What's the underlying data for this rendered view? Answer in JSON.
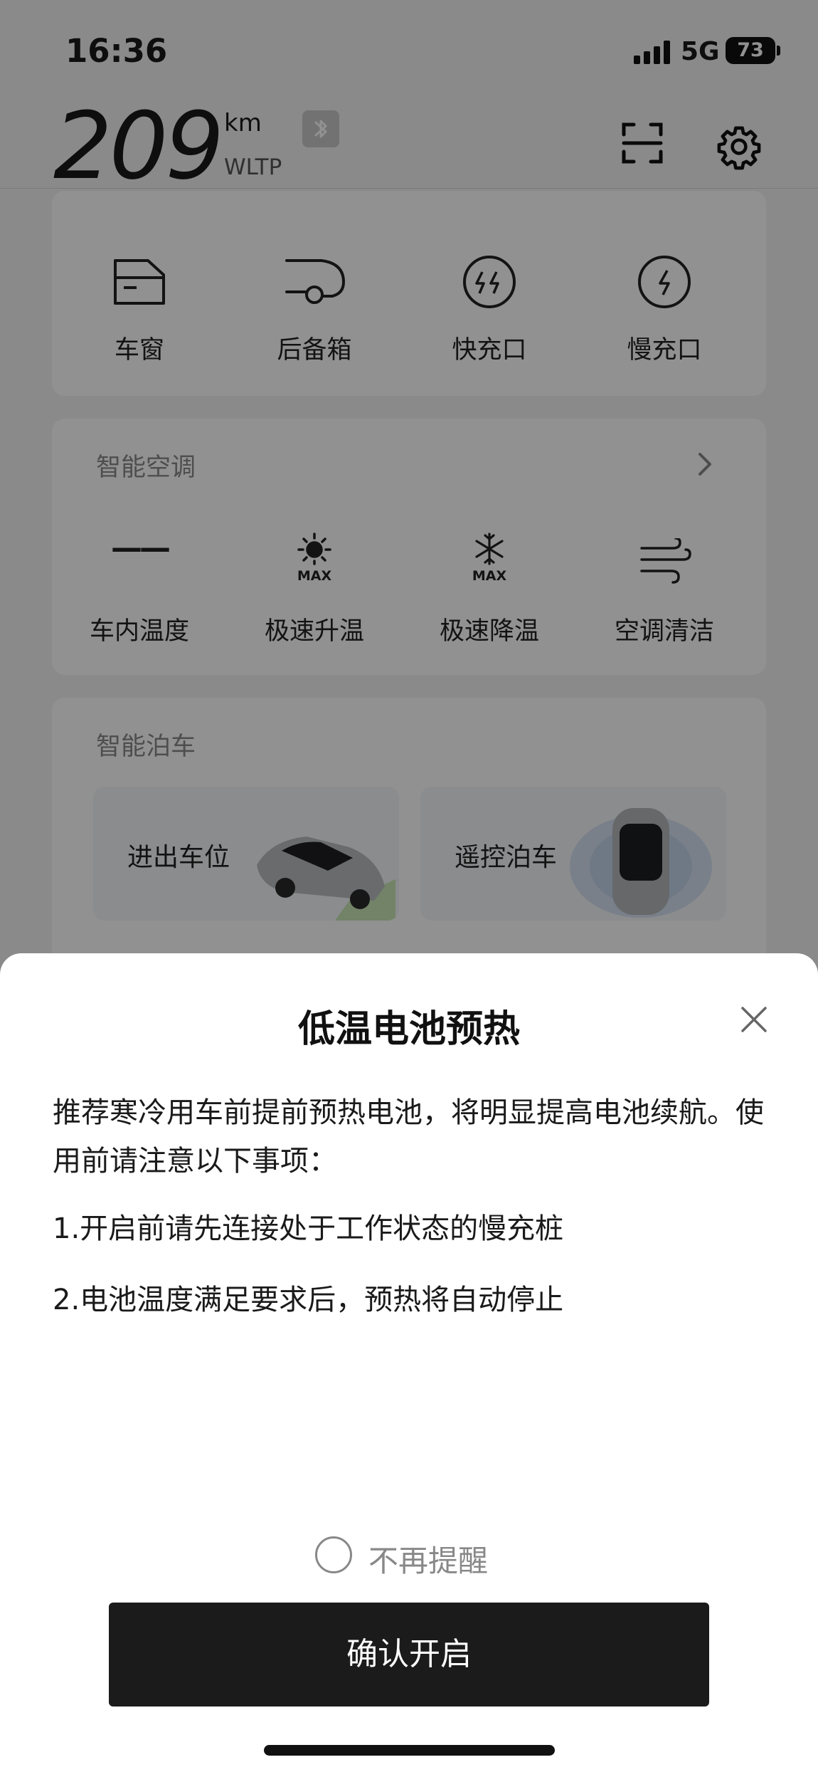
{
  "status_bar": {
    "time": "16:36",
    "network": "5G",
    "battery": "73"
  },
  "header": {
    "range_value": "209",
    "range_unit": "km",
    "range_standard": "WLTP"
  },
  "controls": {
    "items": [
      {
        "label": "车窗",
        "icon": "window-icon"
      },
      {
        "label": "后备箱",
        "icon": "trunk-icon"
      },
      {
        "label": "快充口",
        "icon": "fast-charge-port-icon"
      },
      {
        "label": "慢充口",
        "icon": "slow-charge-port-icon"
      }
    ]
  },
  "climate": {
    "title": "智能空调",
    "temperature_value": "——",
    "items": [
      {
        "label": "车内温度",
        "icon": "temperature-dash-icon"
      },
      {
        "label": "极速升温",
        "icon": "sun-max-icon"
      },
      {
        "label": "极速降温",
        "icon": "snowflake-max-icon"
      },
      {
        "label": "空调清洁",
        "icon": "wind-icon"
      }
    ],
    "max_text": "MAX"
  },
  "parking": {
    "title": "智能泊车",
    "tiles": [
      {
        "label": "进出车位"
      },
      {
        "label": "遥控泊车"
      }
    ]
  },
  "sheet": {
    "title": "低温电池预热",
    "intro": "推荐寒冷用车前提前预热电池，将明显提高电池续航。使用前请注意以下事项：",
    "notes": [
      "1.开启前请先连接处于工作状态的慢充桩",
      "2.电池温度满足要求后，预热将自动停止"
    ],
    "dont_remind": "不再提醒",
    "confirm": "确认开启"
  }
}
